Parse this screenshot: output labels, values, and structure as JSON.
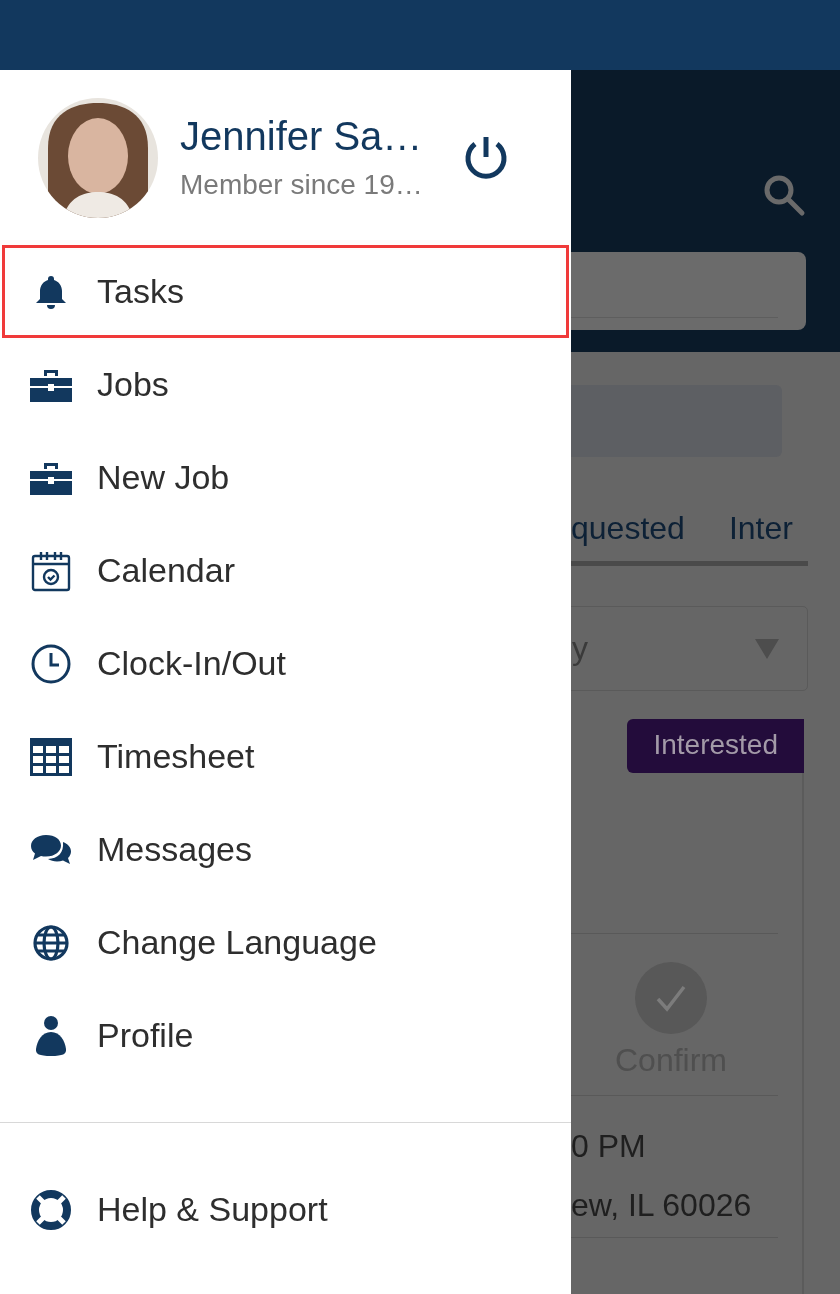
{
  "user": {
    "name": "Jennifer Sa…",
    "member_since": "Member since 19…"
  },
  "menu": [
    {
      "label": "Tasks",
      "selected": true
    },
    {
      "label": "Jobs",
      "selected": false
    },
    {
      "label": "New Job",
      "selected": false
    },
    {
      "label": "Calendar",
      "selected": false
    },
    {
      "label": "Clock-In/Out",
      "selected": false
    },
    {
      "label": "Timesheet",
      "selected": false
    },
    {
      "label": "Messages",
      "selected": false
    },
    {
      "label": "Change Language",
      "selected": false
    },
    {
      "label": "Profile",
      "selected": false
    }
  ],
  "footer_menu": [
    {
      "label": "Help & Support",
      "selected": false
    }
  ],
  "background": {
    "tabs": [
      "quested",
      "Inter"
    ],
    "filter_value": "y",
    "badge": "Interested",
    "confirm_label": "Confirm",
    "lines": [
      "0 PM",
      "ew, IL 60026"
    ]
  }
}
